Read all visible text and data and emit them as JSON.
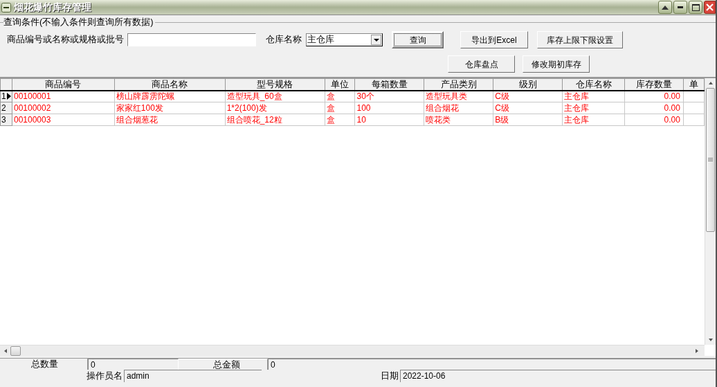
{
  "window": {
    "title": "烟花爆竹库存管理"
  },
  "query": {
    "legend": "查询条件(不输入条件则查询所有数据)",
    "keyword_label": "商品编号或名称或规格或批号",
    "warehouse_label": "仓库名称",
    "warehouse_value": "主仓库",
    "buttons": [
      {
        "label": "查询",
        "focused": true
      },
      {
        "label": "导出到Excel",
        "focused": false
      },
      {
        "label": "库存上限下限设置",
        "focused": false
      },
      {
        "label": "仓库盘点",
        "focused": false
      },
      {
        "label": "修改期初库存",
        "focused": false
      }
    ]
  },
  "table": {
    "columns": [
      "商品编号",
      "商品名称",
      "型号规格",
      "单位",
      "每箱数量",
      "产品类别",
      "级别",
      "仓库名称",
      "库存数量",
      "单"
    ],
    "rows": [
      {
        "number": "1",
        "selected": true,
        "cells": [
          "00100001",
          "榜山牌霹雳陀螺",
          "造型玩具_60盒",
          "盒",
          "30个",
          "造型玩具类",
          "C级",
          "主仓库",
          "0.00",
          ""
        ]
      },
      {
        "number": "2",
        "selected": false,
        "cells": [
          "00100002",
          "家家红100发",
          "1*2(100)发",
          "盒",
          "100",
          "组合烟花",
          "C级",
          "主仓库",
          "0.00",
          ""
        ]
      },
      {
        "number": "3",
        "selected": false,
        "cells": [
          "00100003",
          "组合烟葱花",
          "组合喷花_12粒",
          "盒",
          "10",
          "喷花类",
          "B级",
          "主仓库",
          "0.00",
          ""
        ]
      }
    ]
  },
  "footer": {
    "total_qty_label": "总数量",
    "total_qty": "0",
    "total_amount_label": "总金额",
    "total_amount": "0",
    "operator_label": "操作员名",
    "operator": "admin",
    "date_label": "日期",
    "date": "2022-10-06"
  }
}
